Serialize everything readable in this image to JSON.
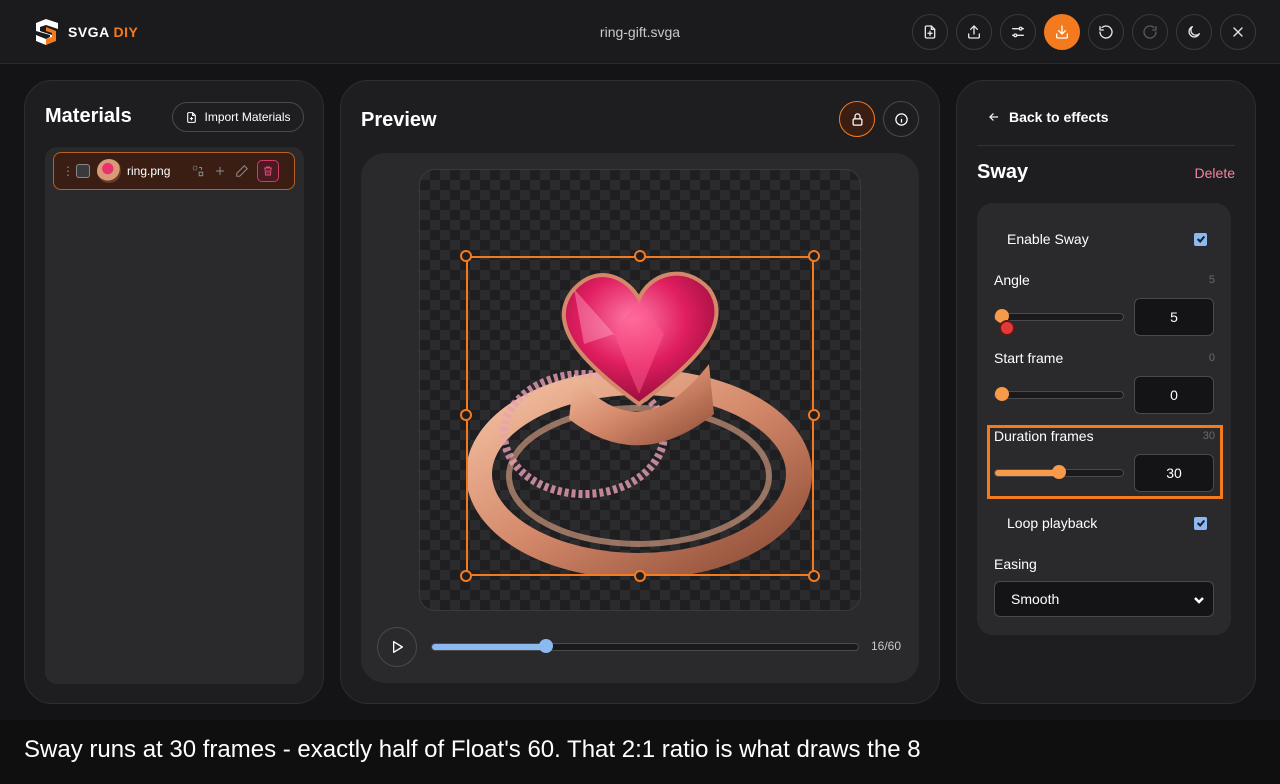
{
  "app": {
    "logo_text": "SVGA",
    "logo_accent": "DIY",
    "file_name": "ring-gift.svga",
    "accent_color": "#f47a20"
  },
  "toolbar": {
    "buttons": [
      "new-file-icon",
      "upload-icon",
      "settings-sliders-icon",
      "download-icon",
      "undo-icon",
      "redo-icon",
      "moon-icon",
      "close-icon"
    ]
  },
  "materials": {
    "title": "Materials",
    "import_label": "Import Materials",
    "items": [
      {
        "name": "ring.png",
        "checked": false
      }
    ]
  },
  "preview": {
    "title": "Preview",
    "current_frame": 16,
    "total_frames": 60,
    "frame_label": "16/60"
  },
  "effects": {
    "back_label": "Back to effects",
    "effect_title": "Sway",
    "delete_label": "Delete",
    "enable_label": "Enable Sway",
    "enable_checked": true,
    "angle": {
      "label": "Angle",
      "value": "5",
      "min": 0,
      "max": 180,
      "display": "5"
    },
    "start_frame": {
      "label": "Start frame",
      "value": "0",
      "min": 0,
      "max": 60,
      "display": "0"
    },
    "duration": {
      "label": "Duration frames",
      "value": "30",
      "min": 1,
      "max": 60,
      "display": "30"
    },
    "loop_label": "Loop playback",
    "loop_checked": true,
    "easing_label": "Easing",
    "easing_value": "Smooth"
  },
  "caption": {
    "text": "Sway runs at 30 frames - exactly half of Float's 60. That 2:1 ratio is what draws the 8"
  }
}
